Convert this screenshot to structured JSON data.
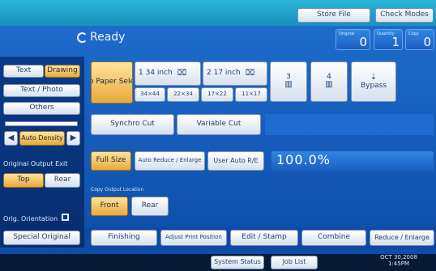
{
  "top": {
    "store_file": "Store File",
    "check_modes": "Check Modes"
  },
  "status": {
    "title": "Ready"
  },
  "counters": [
    {
      "label": "Original",
      "value": "0"
    },
    {
      "label": "Quantity",
      "value": "1"
    },
    {
      "label": "Copy",
      "value": "0"
    }
  ],
  "left": {
    "text": "Text",
    "drawing": "Drawing",
    "text_photo": "Text / Photo",
    "others": "Others",
    "auto_density": "Auto Density",
    "orig_output_exit": "Original Output Exit",
    "top": "Top",
    "rear": "Rear",
    "orig_orientation": "Orig. Orientation",
    "special_original": "Special Original"
  },
  "paper": {
    "auto_select": "Auto Paper Select▶",
    "trays": [
      {
        "label": "1 34 inch",
        "name": "tray-1"
      },
      {
        "label": "2 17 inch",
        "name": "tray-2"
      },
      {
        "label": "3",
        "name": "tray-3"
      },
      {
        "label": "4",
        "name": "tray-4"
      }
    ],
    "bypass": "Bypass",
    "sizes": [
      "34×44",
      "22×34",
      "17×22",
      "11×17"
    ]
  },
  "cuts": {
    "synchro": "Synchro Cut",
    "variable": "Variable Cut"
  },
  "reduce": {
    "full_size": "Full Size",
    "auto_reduce": "Auto Reduce / Enlarge",
    "user_auto": "User Auto R/E",
    "ratio": "100.0%"
  },
  "copy_output": {
    "label": "Copy Output Location",
    "front": "Front",
    "rear": "Rear"
  },
  "tabs": [
    "Finishing",
    "Adjust Print Position",
    "Edit / Stamp",
    "Combine",
    "Reduce / Enlarge"
  ],
  "bottom": {
    "system_status": "System Status",
    "job_list": "Job List",
    "date": "OCT 30,2008",
    "time": "1:45PM"
  }
}
